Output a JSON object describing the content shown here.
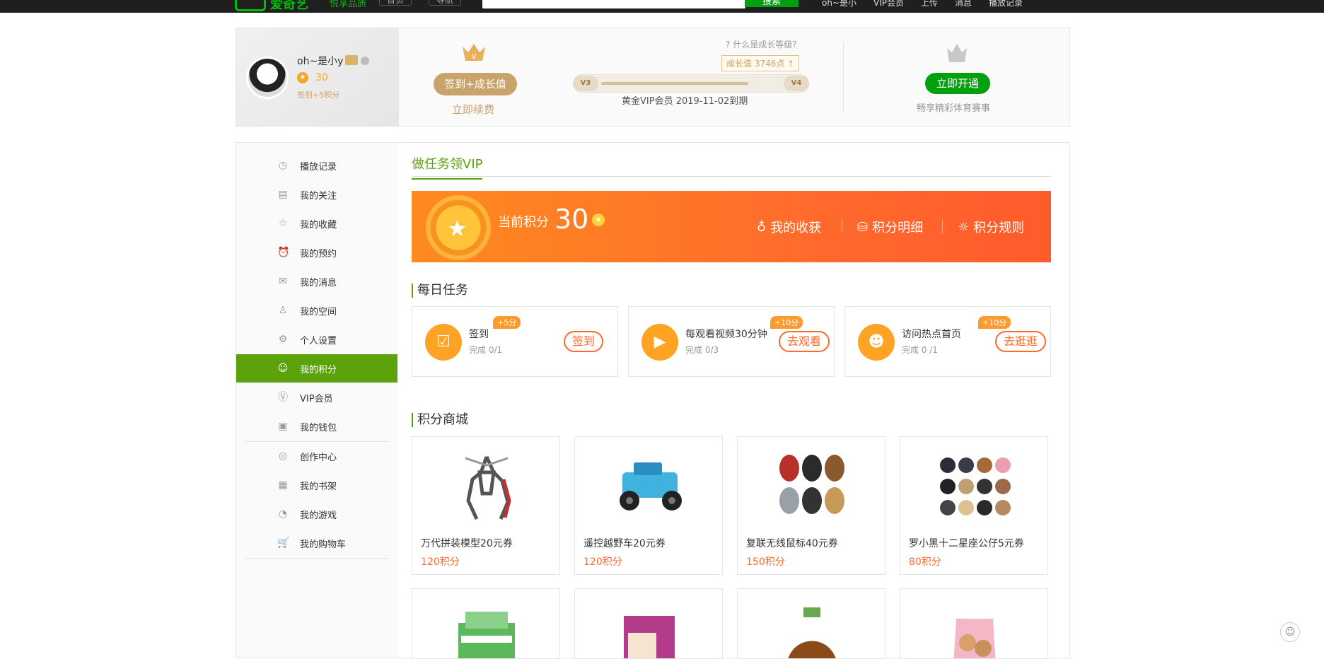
{
  "topbar": {
    "logo_text": "爱奇艺",
    "slogan": "悦享品质",
    "nav_home": "首页",
    "nav_guide": "导航",
    "search_button": "搜索",
    "links": [
      "oh~是小",
      "VIP会员",
      "上传",
      "消息",
      "播放记录"
    ]
  },
  "profile": {
    "username": "oh~是小y",
    "points": "30",
    "sign_tip": "签到+5积分",
    "sign_button": "签到+成长值",
    "renew_link": "立即续费",
    "growth_question": "什么是成长等级?",
    "growth_value": "成长值  3746点",
    "level_from": "V3",
    "level_to": "V4",
    "growth_progress": 0.82,
    "vip_expire": "黄金VIP会员  2019-11-02到期",
    "open_button": "立即开通",
    "open_tip": "畅享精彩体育赛事"
  },
  "sidebar": {
    "items": [
      {
        "label": "播放记录",
        "icon": "clock-icon"
      },
      {
        "label": "我的关注",
        "icon": "book-icon"
      },
      {
        "label": "我的收藏",
        "icon": "star-icon"
      },
      {
        "label": "我的预约",
        "icon": "alarm-icon"
      },
      {
        "label": "我的消息",
        "icon": "mail-icon"
      },
      {
        "label": "我的空间",
        "icon": "user-icon"
      },
      {
        "label": "个人设置",
        "icon": "gear-icon"
      },
      {
        "label": "我的积分",
        "icon": "coin-icon",
        "active": true
      },
      {
        "label": "VIP会员",
        "icon": "vip-icon"
      },
      {
        "label": "我的钱包",
        "icon": "wallet-icon"
      },
      {
        "label": "创作中心",
        "icon": "create-icon"
      },
      {
        "label": "我的书架",
        "icon": "shelf-icon"
      },
      {
        "label": "我的游戏",
        "icon": "game-icon"
      },
      {
        "label": "我的购物车",
        "icon": "cart-icon"
      }
    ]
  },
  "content": {
    "section_title": "做任务领VIP",
    "banner": {
      "current_label": "当前积分",
      "current_points": "30",
      "link_earnings": "我的收获",
      "link_detail": "积分明细",
      "link_rules": "积分规则"
    },
    "daily_title": "每日任务",
    "tasks": [
      {
        "name": "签到",
        "progress": "完成 0/1",
        "bonus": "+5分",
        "button": "签到"
      },
      {
        "name": "每观看视频30分钟",
        "progress": "完成 0/3",
        "bonus": "+10分",
        "button": "去观看"
      },
      {
        "name": "访问热点首页",
        "progress": "完成 0 /1",
        "bonus": "+10分",
        "button": "去逛逛"
      }
    ],
    "mall_title": "积分商城",
    "products": [
      {
        "name": "万代拼装模型20元券",
        "points": "120积分"
      },
      {
        "name": "遥控越野车20元券",
        "points": "120积分"
      },
      {
        "name": "复联无线鼠标40元券",
        "points": "150积分"
      },
      {
        "name": "罗小黑十二星座公仔5元券",
        "points": "80积分"
      }
    ]
  },
  "colors": {
    "green": "#5ca30b",
    "orange": "#ff6a2a",
    "gold": "#c9a36c"
  }
}
